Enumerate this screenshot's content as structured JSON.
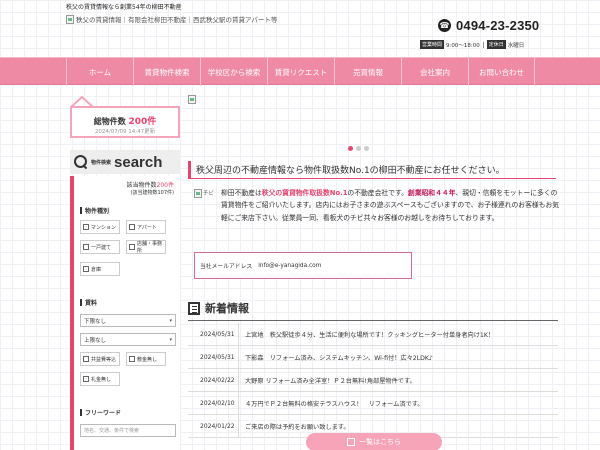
{
  "header": {
    "tagline": "秩父の賃貸情報なら創業54年の柳田不動産",
    "logo_alt": "秩父の賃貸情報｜有限会社柳田不動産｜西武秩父駅の賃貸アパート等",
    "phone": "0494-23-2350",
    "hours_tag": "営業時間",
    "hours_value": "9:00～18:00",
    "closed_tag": "定休日",
    "closed_value": "水曜日"
  },
  "nav": {
    "items": [
      {
        "label": "ホーム"
      },
      {
        "label": "賃貸物件検索"
      },
      {
        "label": "学校区から検索"
      },
      {
        "label": "賃貸リクエスト"
      },
      {
        "label": "売買情報"
      },
      {
        "label": "会社案内"
      },
      {
        "label": "お問い合わせ"
      }
    ]
  },
  "sidebar": {
    "total_label": "総物件数",
    "total_count": "200件",
    "updated": "2024/07/09 14:47更新",
    "search_small": "物件検索",
    "search_big": "search",
    "hit_label": "該当物件数",
    "hit_count": "200件",
    "hit_sub": "(該当建物数107件)",
    "type_title": "物件種別",
    "types": [
      "マンション",
      "アパート",
      "一戸建て",
      "店舗・事務所",
      "倉庫"
    ],
    "rent_title": "賃料",
    "rent_min": "下限なし",
    "rent_max": "上限なし",
    "fee_options": [
      "共益費等込",
      "敷金無し",
      "礼金無し"
    ],
    "free_title": "フリーワード",
    "free_placeholder": "地名、交通、条件で検索"
  },
  "main": {
    "lead": "秩父周辺の不動産情報なら物件取扱数No.1の柳田不動産にお任せください。",
    "company_logo_alt": "チビ",
    "intro_1": "柳田不動産は",
    "intro_hl1": "秩父の賃貸物件取扱数No.1",
    "intro_2": "の不動産会社です。",
    "intro_hl2": "創業昭和４４年",
    "intro_3": "、親切・信頼をモットーに多くの賃貸物件をご紹介いたします。店内にはお子さまの遊ぶスペースもございますので、お子様連れのお客様もお気軽にご来店下さい。従業員一同、看板犬のチビ共々お客様のお越しをお待ちしております。",
    "mail_label": "当社メールアドレス",
    "mail": "info@e-yanagida.com"
  },
  "news": {
    "title": "新着情報",
    "items": [
      {
        "date": "2024/05/31",
        "text": "上宮地　秩父駅徒歩４分、生活に便利な場所です！クッキングヒーター付単身者向け1K！"
      },
      {
        "date": "2024/05/31",
        "text": "下影森　リフォーム済み、システムキッチン、Wi-fi付！広々2LDK♪"
      },
      {
        "date": "2024/02/22",
        "text": "大野原 リフォーム済み全洋室！Ｐ２台無料!角部屋物件です。"
      },
      {
        "date": "2024/02/10",
        "text": "４万円でＰ２台無料の格安テラスハウス！　リフォーム済です。"
      },
      {
        "date": "2024/01/22",
        "text": "ご来店の際は予約をお願い致します。"
      }
    ],
    "more_label": "一覧はこちら"
  }
}
